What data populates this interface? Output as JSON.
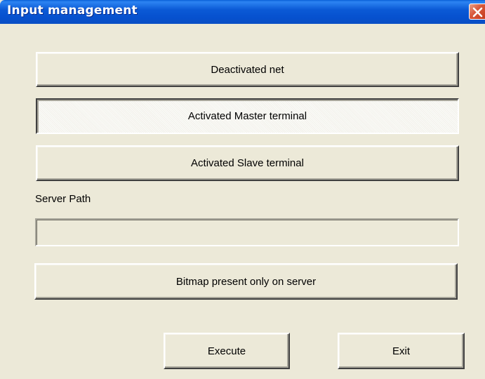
{
  "window": {
    "title": "Input management"
  },
  "buttons": {
    "deactivated_net": "Deactivated net",
    "activated_master": "Activated Master terminal",
    "activated_slave": "Activated Slave terminal",
    "bitmap_server": "Bitmap present only on server",
    "execute": "Execute",
    "exit": "Exit"
  },
  "server_path": {
    "label": "Server Path",
    "value": ""
  },
  "state": {
    "pressed_button": "Activated Master terminal"
  },
  "icons": {
    "close": "close-icon"
  },
  "colors": {
    "titlebar": "#0650ce",
    "dialog_bg": "#ece9d8",
    "close_button": "#d8573a"
  }
}
